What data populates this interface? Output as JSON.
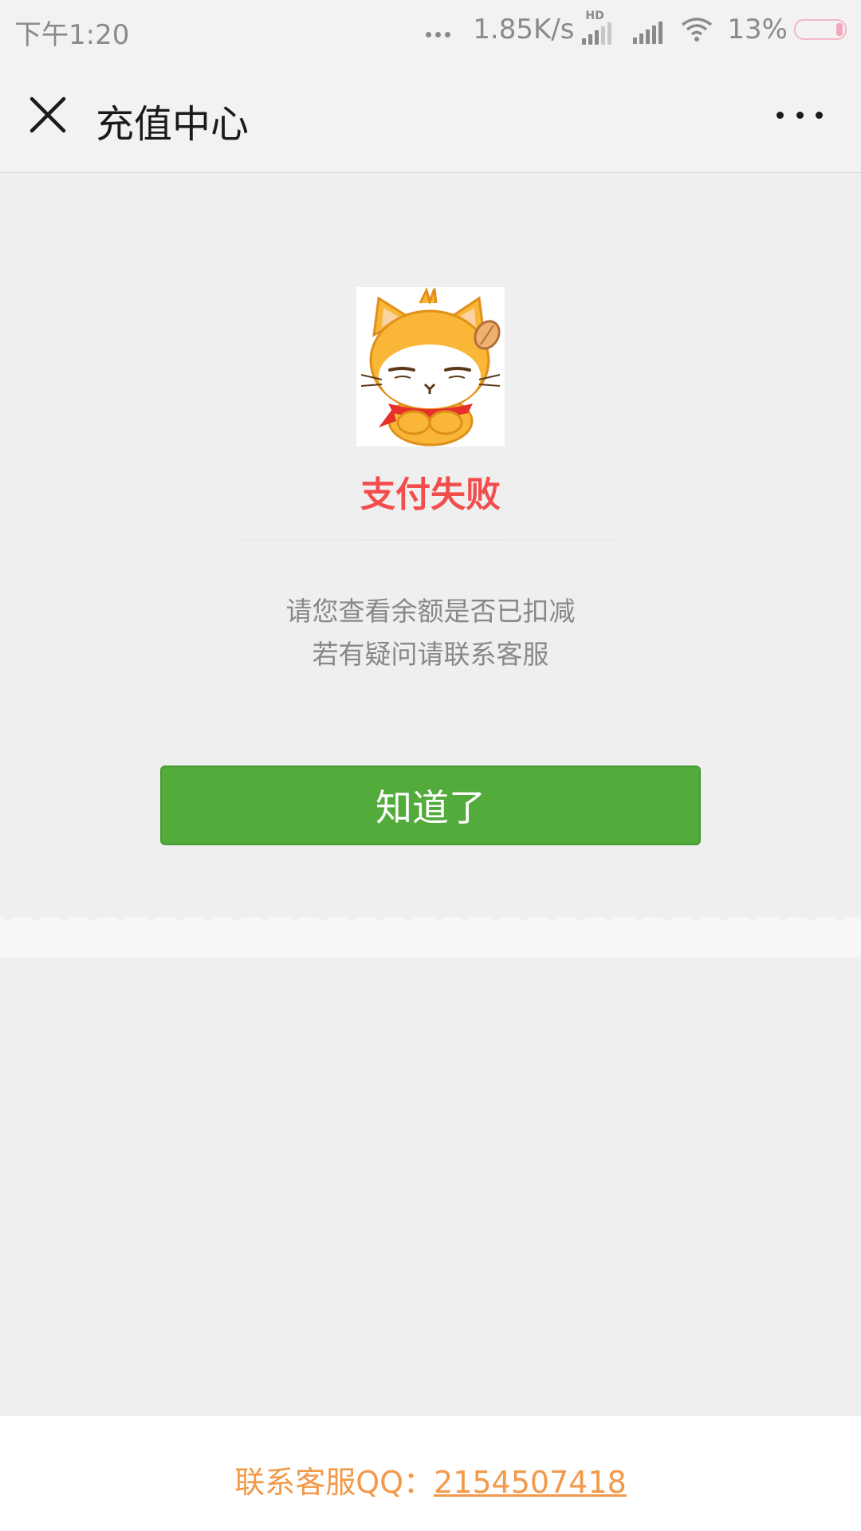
{
  "status_bar": {
    "time": "下午1:20",
    "net_speed": "1.85K/s",
    "hd_label": "HD",
    "battery_percent": "13%",
    "battery_level": 0.13
  },
  "nav": {
    "title": "充值中心",
    "close_icon": "close-icon",
    "more_icon": "more-icon"
  },
  "result": {
    "title": "支付失败",
    "message_line1": "请您查看余额是否已扣减",
    "message_line2": "若有疑问请联系客服",
    "button_label": "知道了",
    "title_color": "#f24d4d",
    "button_color": "#53ab3b"
  },
  "footer": {
    "label": "联系客服QQ：",
    "qq_number": "2154507418",
    "color": "#f2994a"
  }
}
